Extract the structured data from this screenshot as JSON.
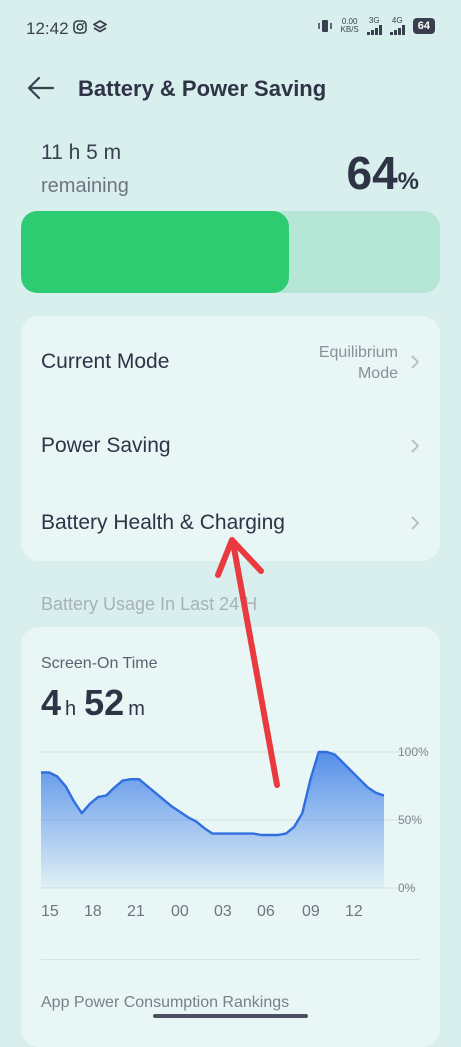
{
  "status_bar": {
    "time": "12:42",
    "net_speed_value": "0.00",
    "net_speed_unit": "KB/S",
    "signal1_label": "3G",
    "signal2_label": "4G",
    "battery_level": "64"
  },
  "header": {
    "title": "Battery & Power Saving"
  },
  "battery": {
    "remaining_time": "11 h 5 m",
    "remaining_label": "remaining",
    "percent_value": "64",
    "percent_sign": "%",
    "level_fraction": 0.64,
    "fill_color": "#2dcc71"
  },
  "menu": {
    "current_mode_label": "Current Mode",
    "current_mode_value_line1": "Equilibrium",
    "current_mode_value_line2": "Mode",
    "power_saving_label": "Power Saving",
    "battery_health_label": "Battery Health & Charging"
  },
  "usage": {
    "section_title": "Battery Usage In Last 24 H",
    "screen_on_label": "Screen-On Time",
    "hours": "4",
    "hours_unit": "h",
    "minutes": "52",
    "minutes_unit": "m",
    "ranking_title": "App Power Consumption Rankings"
  },
  "chart_data": {
    "type": "area",
    "x": [
      "15",
      "18",
      "21",
      "00",
      "03",
      "06",
      "09",
      "12"
    ],
    "y_tick_labels": [
      "100%",
      "50%",
      "0%"
    ],
    "ylim": [
      0,
      100
    ],
    "series": [
      {
        "values": [
          85,
          85,
          82,
          75,
          64,
          55,
          62,
          67,
          68,
          74,
          79,
          80,
          80,
          75,
          70,
          65,
          60,
          56,
          52,
          49,
          44,
          40,
          40,
          40,
          40,
          40,
          40,
          39,
          39,
          39,
          40,
          45,
          55,
          80,
          100,
          100,
          98,
          92,
          86,
          80,
          74,
          70,
          68
        ],
        "color": "#2f6fe0"
      }
    ],
    "grid": true,
    "accent_color": "#2f6fe0"
  },
  "annotation": {
    "arrow_color": "#e93a3f"
  }
}
